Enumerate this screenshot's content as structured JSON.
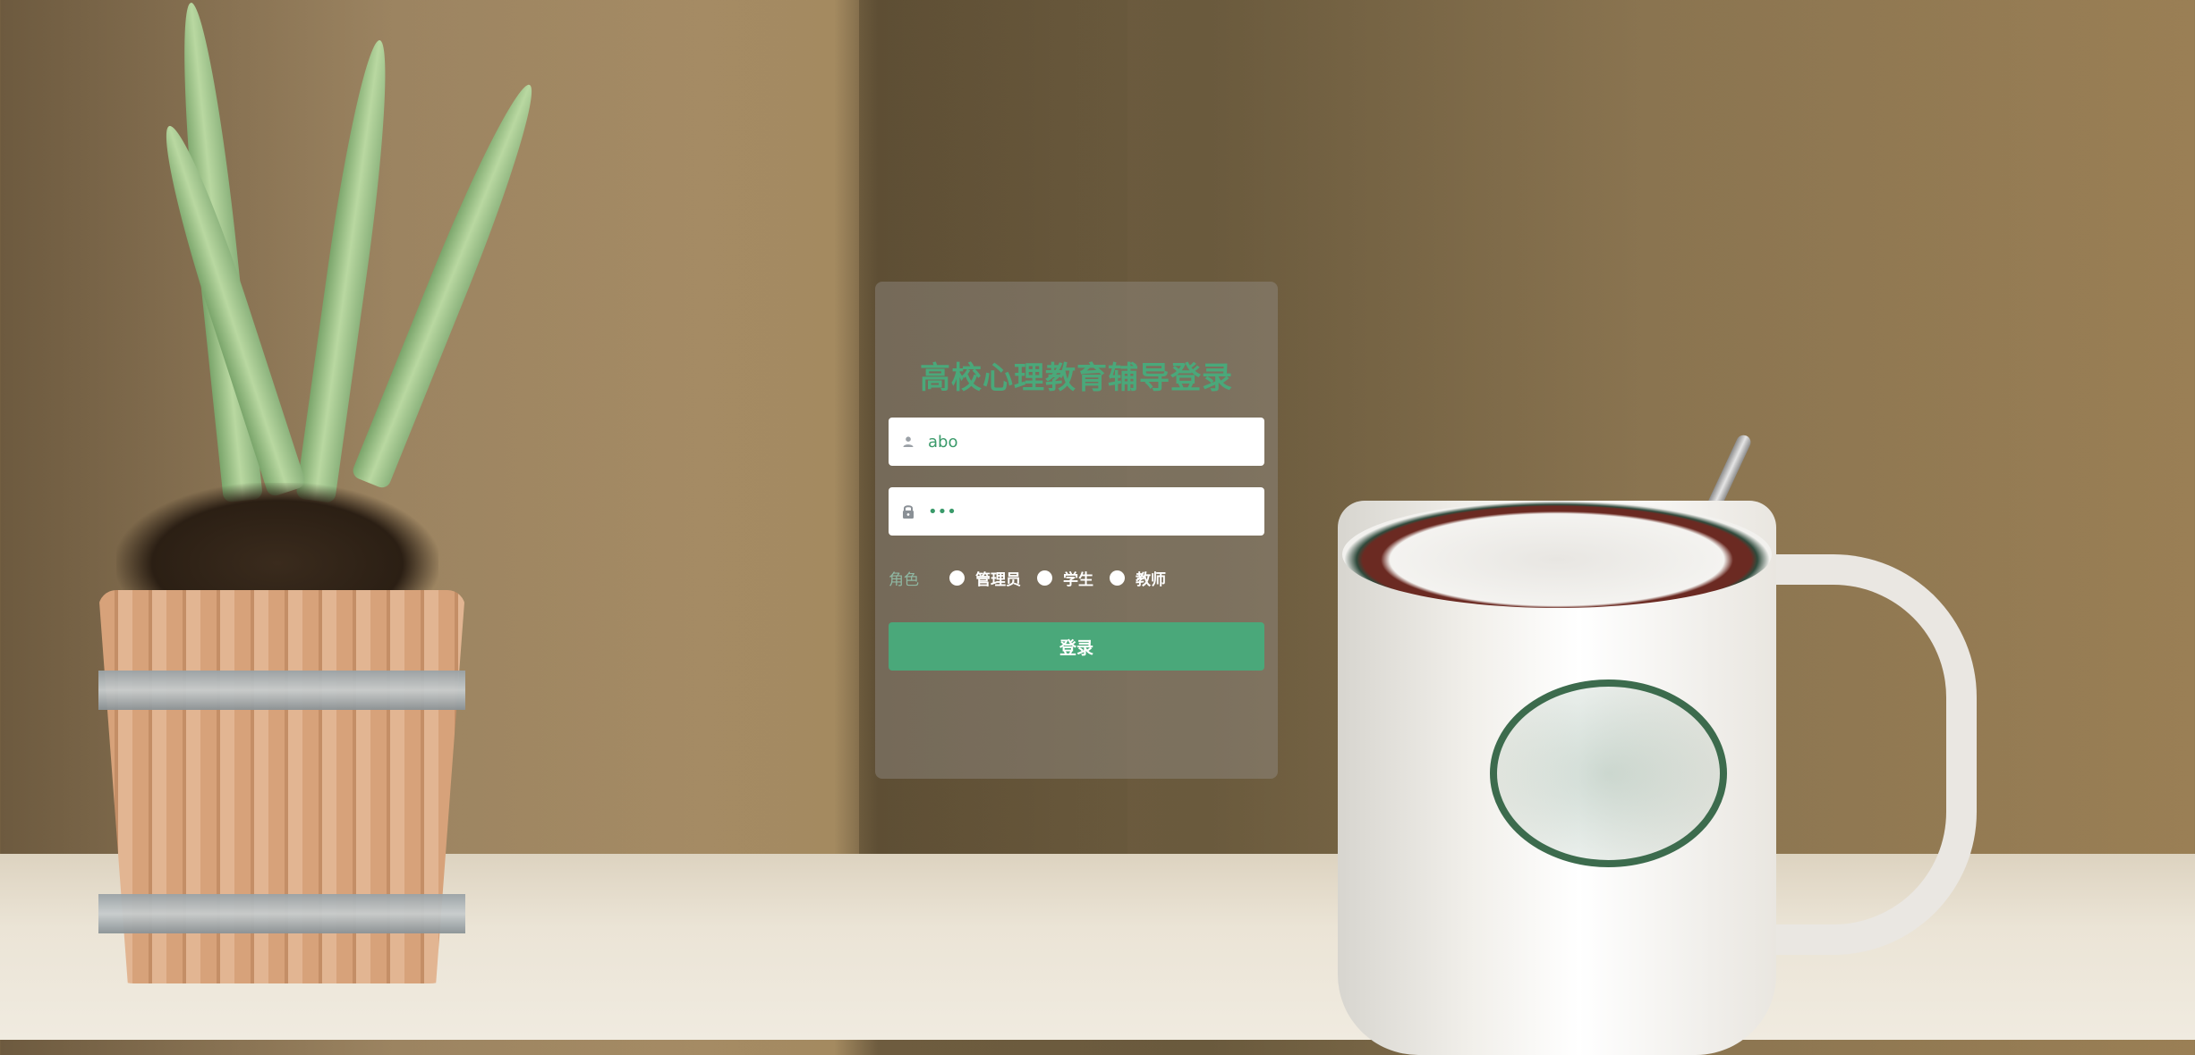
{
  "login": {
    "title": "高校心理教育辅导登录",
    "username": {
      "value": "abo",
      "icon": "user-icon"
    },
    "password": {
      "value": "•••",
      "icon": "lock-icon"
    },
    "role": {
      "label": "角色",
      "options": [
        "管理员",
        "学生",
        "教师"
      ]
    },
    "submit_label": "登录"
  },
  "colors": {
    "accent": "#4aa87a",
    "card_background": "rgba(150,145,140,0.42)"
  }
}
